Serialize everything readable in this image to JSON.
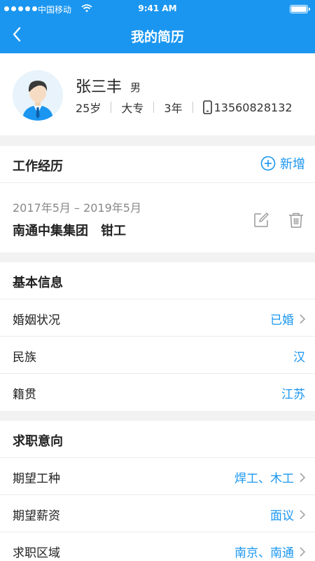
{
  "status_bar": {
    "carrier": "中国移动",
    "time": "9:41 AM"
  },
  "header": {
    "title": "我的简历"
  },
  "profile": {
    "name": "张三丰",
    "gender": "男",
    "age": "25岁",
    "education": "大专",
    "experience": "3年",
    "phone": "13560828132"
  },
  "work": {
    "title": "工作经历",
    "add_label": "新增",
    "entries": [
      {
        "period": "2017年5月 – 2019年5月",
        "company": "南通中集集团",
        "position": "钳工"
      }
    ]
  },
  "basic": {
    "title": "基本信息",
    "rows": [
      {
        "key": "婚姻状况",
        "value": "已婚"
      },
      {
        "key": "民族",
        "value": "汉"
      },
      {
        "key": "籍贯",
        "value": "江苏"
      }
    ]
  },
  "intent": {
    "title": "求职意向",
    "rows": [
      {
        "key": "期望工种",
        "value": "焊工、木工"
      },
      {
        "key": "期望薪资",
        "value": "面议"
      },
      {
        "key": "求职区域",
        "value": "南京、南通"
      }
    ]
  },
  "colors": {
    "accent": "#1a96f0",
    "background": "#f2f2f2"
  }
}
